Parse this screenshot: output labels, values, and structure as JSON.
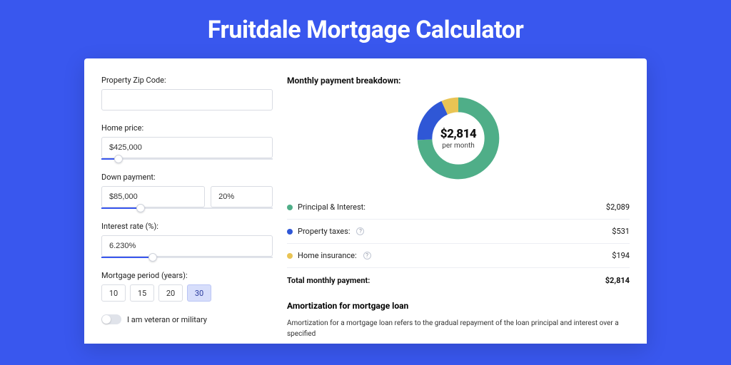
{
  "page": {
    "title": "Fruitdale Mortgage Calculator"
  },
  "inputs": {
    "zip": {
      "label": "Property Zip Code:",
      "value": ""
    },
    "price": {
      "label": "Home price:",
      "value": "$425,000",
      "slider_pct": 10
    },
    "down": {
      "label": "Down payment:",
      "amount": "$85,000",
      "pct": "20%",
      "slider_pct": 23
    },
    "rate": {
      "label": "Interest rate (%):",
      "value": "6.230%",
      "slider_pct": 30
    },
    "period": {
      "label": "Mortgage period (years):",
      "options": [
        "10",
        "15",
        "20",
        "30"
      ],
      "active": "30"
    },
    "veteran": {
      "label": "I am veteran or military",
      "on": false
    }
  },
  "breakdown": {
    "title": "Monthly payment breakdown:",
    "donut": {
      "value": "$2,814",
      "sub": "per month"
    },
    "rows": [
      {
        "color": "green",
        "name": "Principal & Interest:",
        "help": false,
        "value": "$2,089"
      },
      {
        "color": "blue",
        "name": "Property taxes:",
        "help": true,
        "value": "$531"
      },
      {
        "color": "yellow",
        "name": "Home insurance:",
        "help": true,
        "value": "$194"
      }
    ],
    "total": {
      "label": "Total monthly payment:",
      "value": "$2,814"
    }
  },
  "amort": {
    "title": "Amortization for mortgage loan",
    "body": "Amortization for a mortgage loan refers to the gradual repayment of the loan principal and interest over a specified"
  },
  "chart_data": {
    "type": "pie",
    "title": "Monthly payment breakdown",
    "series": [
      {
        "name": "Principal & Interest",
        "value": 2089,
        "color": "#4fae88"
      },
      {
        "name": "Property taxes",
        "value": 531,
        "color": "#2f57d6"
      },
      {
        "name": "Home insurance",
        "value": 194,
        "color": "#e9c454"
      }
    ],
    "total": 2814,
    "center_label": "$2,814 per month"
  }
}
